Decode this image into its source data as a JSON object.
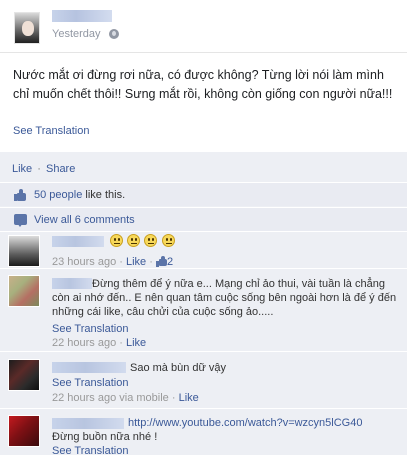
{
  "post": {
    "time": "Yesterday",
    "text": "Nước mắt ơi đừng rơi nữa, có được không? Từng lời nói làm mình chỉ muốn chết thôi!! Sưng mắt rồi, không còn giống con người nữa!!!",
    "see_translation": "See Translation"
  },
  "actions": {
    "like": "Like",
    "share": "Share",
    "sep": "·"
  },
  "feedback": {
    "likes_link": "50 people",
    "likes_suffix": " like this.",
    "comments_link": "View all 6 comments"
  },
  "comments": [
    {
      "text": "",
      "time": "23 hours ago",
      "like": "Like",
      "likes": "2"
    },
    {
      "text": "Đừng thêm để ý nữa e... Mạng chỉ ảo thui, vài tuần là chẳng còn ai nhớ đến.. E nên quan tâm cuộc sống bên ngoài hơn là để ý đến những cái like, câu chửi của cuộc sống ảo.....",
      "see_translation": "See Translation",
      "time": "22 hours ago",
      "like": "Like"
    },
    {
      "text": "Sao mà bùn dữ vậy",
      "see_translation": "See Translation",
      "time": "22 hours ago via mobile",
      "like": "Like"
    },
    {
      "link": "http://www.youtube.com/watch?v=wzcyn5lCG40",
      "text": "Đừng buồn nữa nhé !",
      "see_translation": "See Translation"
    }
  ],
  "colors": {
    "link": "#3b5998",
    "feedback_bg": "#edeff4",
    "meta": "#999999"
  },
  "icons": [
    "globe-icon",
    "like-thumb-icon",
    "comment-icon",
    "emoticon-icon"
  ]
}
